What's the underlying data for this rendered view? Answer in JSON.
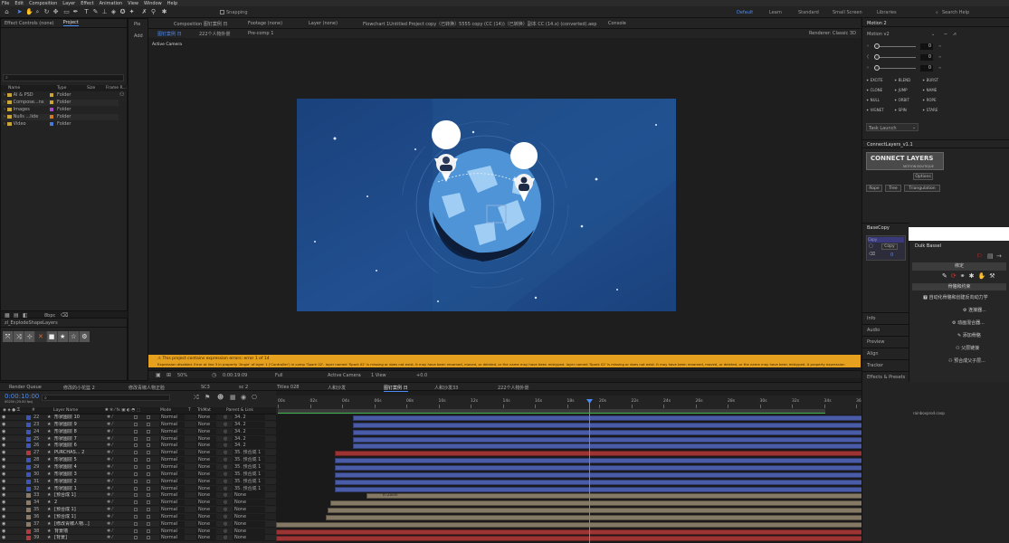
{
  "menu": {
    "items": [
      "File",
      "Edit",
      "Composition",
      "Layer",
      "Effect",
      "Animation",
      "View",
      "Window",
      "Help"
    ]
  },
  "toolbar": {
    "snapping": "Snapping",
    "workspaces": [
      "Default",
      "Learn",
      "Standard",
      "Small Screen",
      "Libraries"
    ],
    "search_placeholder": "Search Help"
  },
  "left_panel": {
    "tabs": [
      "Effect Controls (none)",
      "Project"
    ],
    "search_placeholder": "",
    "columns": [
      "Name",
      "Type",
      "Size",
      "Frame R..."
    ],
    "items": [
      {
        "name": "AI & PSD",
        "type": "Folder"
      },
      {
        "name": "Compose...ns",
        "type": "Folder"
      },
      {
        "name": "Images",
        "type": "Folder"
      },
      {
        "name": "Nulls ...lide",
        "type": "Folder"
      },
      {
        "name": "Video",
        "type": "Folder"
      }
    ],
    "footer_label": "8bpc",
    "script_panel_title": "zl_ExplodeShapeLayers"
  },
  "header_tabs": {
    "pie": "Pie",
    "add": "Add",
    "composition": "Composition 图钉案例 日",
    "footage": "Footage (none)",
    "layer": "Layer (none)",
    "flowchart": "Flowchart 1Untitled Project copy（已转换）5555 copy (CC (14))（已转换）副本 CC (14.x) (converted).aep",
    "console": "Console",
    "sub_tabs": [
      "图钉案例 日",
      "222个人物外景",
      "Pre-comp 1"
    ],
    "renderer_label": "Renderer:",
    "renderer_value": "Classic 3D"
  },
  "viewer": {
    "active_camera": "Active Camera"
  },
  "warning": {
    "text": "This project contains expression errors: error 1 of 14",
    "detail": "Expression disabled. Error at line 3 in property 'Angle' of layer 1 ('Controller') in comp 'Spark 02'. layer named 'Spark 02' is missing or does not exist. It may have been renamed, moved, or deleted, or the name may have been mistyped. layer named 'Spark 02' is missing or does not exist. It may have been renamed, moved, or deleted, or the name may have been mistyped. A property expression"
  },
  "viewer_bar": {
    "zoom": "50%",
    "time": "0:00:19:09",
    "resolution": "Full",
    "camera": "Active Camera",
    "views": "1 View",
    "exposure": "+0.0"
  },
  "timeline": {
    "render_queue": "Render Queue",
    "tabs": [
      "修改的小花篮 2",
      "修改青椒人物正脸",
      "SC3",
      "sc 2",
      "Titles 028",
      "人和沙发",
      "人和沙发33",
      "图钉案例 日",
      "222个人物外景"
    ],
    "timecode": "0:00:10:00",
    "frame_info": "00250 (25.00 fps)",
    "search_placeholder": "",
    "col_headers": {
      "num": "#",
      "name": "Layer Name",
      "mode": "Mode",
      "t": "T",
      "trkmat": "TrkMat",
      "parent": "Parent & Link"
    },
    "ruler": [
      "00s",
      "02s",
      "04s",
      "06s",
      "08s",
      "10s",
      "12s",
      "14s",
      "16s",
      "18s",
      "20s",
      "22s",
      "24s",
      "26s",
      "28s",
      "30s",
      "32s",
      "34s",
      "36s",
      "38s"
    ],
    "layers": [
      {
        "num": "22",
        "name": "形状图层 10",
        "mode": "Normal",
        "trk": "None",
        "parent": "34. 2",
        "color": "#3b56b8",
        "bar": "#4a5ca8"
      },
      {
        "num": "23",
        "name": "形状图层 9",
        "mode": "Normal",
        "trk": "None",
        "parent": "34. 2",
        "color": "#3b56b8",
        "bar": "#4a5ca8"
      },
      {
        "num": "24",
        "name": "形状图层 8",
        "mode": "Normal",
        "trk": "None",
        "parent": "34. 2",
        "color": "#3b56b8",
        "bar": "#4a5ca8"
      },
      {
        "num": "25",
        "name": "形状图层 7",
        "mode": "Normal",
        "trk": "None",
        "parent": "34. 2",
        "color": "#3b56b8",
        "bar": "#4a5ca8"
      },
      {
        "num": "26",
        "name": "形状图层 6",
        "mode": "Normal",
        "trk": "None",
        "parent": "34. 2",
        "color": "#3b56b8",
        "bar": "#4a5ca8"
      },
      {
        "num": "27",
        "name": "PURCHAS... 2",
        "mode": "Normal",
        "trk": "None",
        "parent": "35. 预合成 1",
        "color": "#b23a3a",
        "bar": "#9c3434"
      },
      {
        "num": "28",
        "name": "形状图层 5",
        "mode": "Normal",
        "trk": "None",
        "parent": "35. 预合成 1",
        "color": "#3b56b8",
        "bar": "#4a5ca8"
      },
      {
        "num": "29",
        "name": "形状图层 4",
        "mode": "Normal",
        "trk": "None",
        "parent": "35. 预合成 1",
        "color": "#3b56b8",
        "bar": "#4a5ca8"
      },
      {
        "num": "30",
        "name": "形状图层 3",
        "mode": "Normal",
        "trk": "None",
        "parent": "35. 预合成 1",
        "color": "#3b56b8",
        "bar": "#4a5ca8"
      },
      {
        "num": "31",
        "name": "形状图层 2",
        "mode": "Normal",
        "trk": "None",
        "parent": "35. 预合成 1",
        "color": "#3b56b8",
        "bar": "#4a5ca8"
      },
      {
        "num": "32",
        "name": "形状图层 1",
        "mode": "Normal",
        "trk": "None",
        "parent": "35. 预合成 1",
        "color": "#3b56b8",
        "bar": "#4a5ca8"
      },
      {
        "num": "33",
        "name": "[预合成 1]",
        "mode": "Normal",
        "trk": "None",
        "parent": "None",
        "color": "#8a7a66",
        "bar": "#857865"
      },
      {
        "num": "34",
        "name": "2",
        "mode": "Normal",
        "trk": "None",
        "parent": "None",
        "color": "#8a7a66",
        "bar": "#857865"
      },
      {
        "num": "35",
        "name": "[预合成 1]",
        "mode": "Normal",
        "trk": "None",
        "parent": "None",
        "color": "#8a7a66",
        "bar": "#857865"
      },
      {
        "num": "36",
        "name": "[预合成 1]",
        "mode": "Normal",
        "trk": "None",
        "parent": "None",
        "color": "#8a7a66",
        "bar": "#857865"
      },
      {
        "num": "37",
        "name": "[修改青椒人物...]",
        "mode": "Normal",
        "trk": "None",
        "parent": "None",
        "color": "#8a7a66",
        "bar": "#857865"
      },
      {
        "num": "38",
        "name": "背景墙",
        "mode": "Normal",
        "trk": "None",
        "parent": "None",
        "color": "#b23a3a",
        "bar": "#9c3434"
      },
      {
        "num": "39",
        "name": "[背景]",
        "mode": "Normal",
        "trk": "None",
        "parent": "None",
        "color": "#b23a3a",
        "bar": "#9c3434"
      }
    ],
    "markers": [
      "In Zoom",
      "Out Zoom"
    ]
  },
  "right_panel": {
    "motion_tab": "Motion 2",
    "motion_version": "Motion v2",
    "slider_values": [
      "0",
      "0",
      "0"
    ],
    "motion_buttons": [
      "EXCITE",
      "BLEND",
      "BURST",
      "CLONE",
      "JUMP",
      "NAME",
      "NULL",
      "ORBIT",
      "ROPE",
      "VIGNET",
      "SPIN",
      "STARE"
    ],
    "task_launch": "Task Launch",
    "connect_tab": "ConnectLayers_v1.1",
    "connect_logo": "CONNECT LAYERS",
    "connect_sub": "MOTION BOUTIQUE",
    "options": "Options",
    "connect_buttons": [
      "Rope",
      "Tree",
      "Triangulation"
    ],
    "basecopy_tab": "BaseCopy",
    "copy_label": "Copy",
    "copy_btn": "Copy",
    "copy_index": "0",
    "stack": [
      "Info",
      "Audio",
      "Preview",
      "Align",
      "Tracker",
      "Effects & Presets"
    ],
    "footer": "rainboxprod.coop"
  },
  "duik": {
    "title": "Duik Bassel",
    "section_label": "绑定",
    "sub_label": "骨骼和约束",
    "items": [
      "自动化骨骼和创建反向动力学",
      "连接器...",
      "动画混合器...",
      "添加骨骼",
      "父层链接",
      "预合成父子层..."
    ]
  }
}
